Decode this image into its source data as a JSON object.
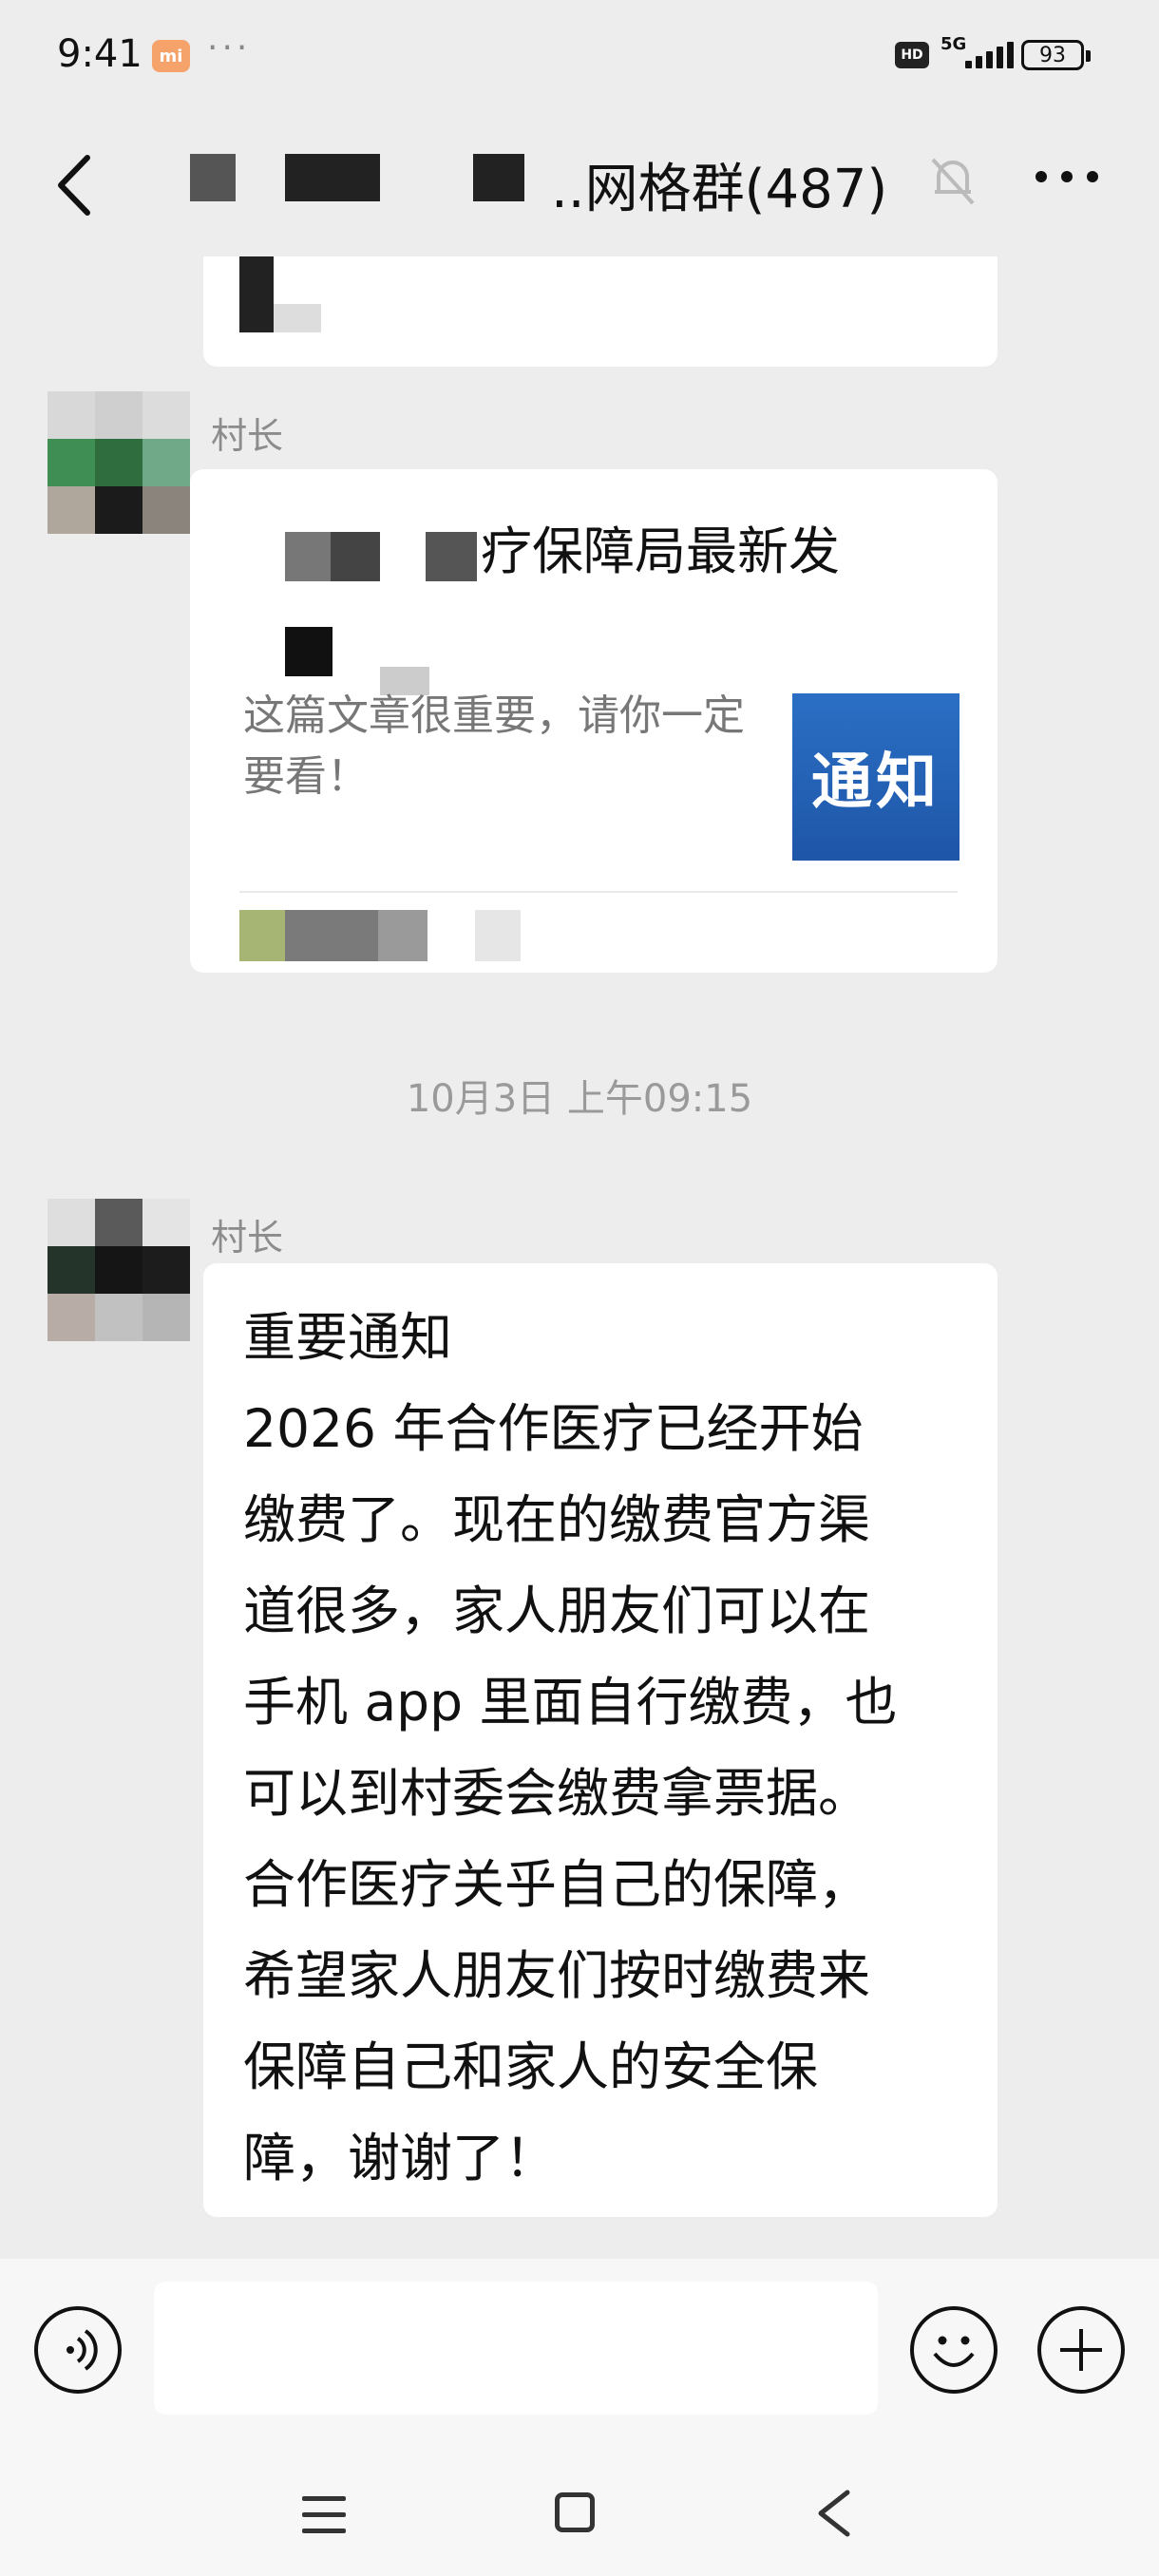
{
  "status_bar": {
    "time": "9:41",
    "app_badge": "mi",
    "more_dots": "···",
    "hd": "HD",
    "network": "5G",
    "battery": "93"
  },
  "nav": {
    "title_suffix": "..网格群(487)"
  },
  "messages": {
    "first_sender": "村长",
    "card_title": "疗保障局最新发",
    "card_desc": "这篇文章很重要，请你一定要看！",
    "card_thumb_text": "通知",
    "timestamp": "10月3日 上午09:15",
    "second_sender": "村长",
    "notice": "重要通知\n2026 年合作医疗已经开始\n缴费了。现在的缴费官方渠\n道很多，家人朋友们可以在\n手机 app 里面自行缴费，也\n可以到村委会缴费拿票据。\n合作医疗关乎自己的保障，\n希望家人朋友们按时缴费来\n保障自己和家人的安全保\n障，谢谢了！"
  },
  "input": {
    "value": "",
    "placeholder": ""
  },
  "colors": {
    "background": "#ededed",
    "bubble": "#ffffff",
    "thumb": "#1e56a8"
  }
}
